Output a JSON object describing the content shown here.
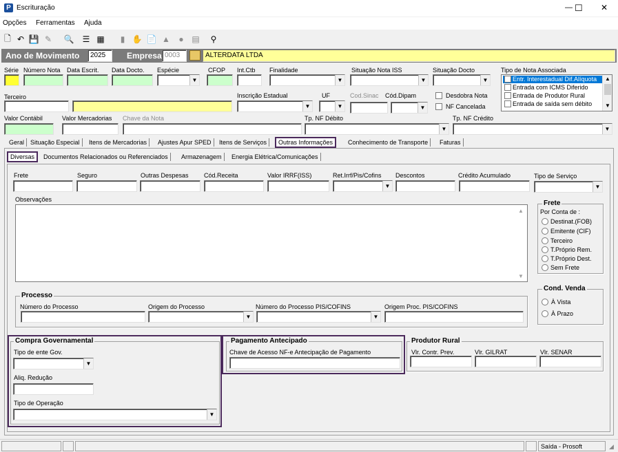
{
  "window": {
    "title": "Escrituração",
    "minimize": "—",
    "maximize": "☐",
    "close": "✕"
  },
  "menu": [
    "Opções",
    "Ferramentas",
    "Ajuda"
  ],
  "header": {
    "ano_label": "Ano de Movimento",
    "ano_value": "2025",
    "empresa_label": "Empresa",
    "empresa_code": "0003",
    "empresa_name": "ALTERDATA LTDA"
  },
  "row1": {
    "serie": "Série",
    "numero_nota": "Número Nota",
    "data_escrit": "Data Escrit.",
    "data_docto": "Data Docto.",
    "especie": "Espécie",
    "cfop": "CFOP",
    "int_ctb": "Int.Ctb",
    "finalidade": "Finalidade",
    "situacao_nota_iss": "Situação Nota ISS",
    "situacao_docto": "Situação Docto",
    "tipo_nota_associada": "Tipo de Nota Associada"
  },
  "tipo_nota_list": [
    {
      "label": "Entr. Interestadual Dif.Alíquota",
      "selected": true
    },
    {
      "label": "Entrada com ICMS Diferido",
      "selected": false
    },
    {
      "label": "Entrada de Produtor Rural",
      "selected": false
    },
    {
      "label": "Entrada de saída sem débito",
      "selected": false
    }
  ],
  "row2": {
    "terceiro": "Terceiro",
    "inscricao_estadual": "Inscrição Estadual",
    "uf": "UF",
    "cod_sinac": "Cod.Sinac",
    "cod_dipam": "Cód.Dipam",
    "desdobra_nota": "Desdobra Nota",
    "nf_cancelada": "NF Cancelada"
  },
  "row3": {
    "valor_contabil": "Valor Contábil",
    "valor_mercadorias": "Valor Mercadorias",
    "chave_nota": "Chave da Nota",
    "tp_nf_debito": "Tp. NF Débito",
    "tp_nf_credito": "Tp. NF Crédito"
  },
  "tabs": [
    "Geral",
    "Situação Especial",
    "Itens de Mercadorias",
    "Ajustes Apur SPED",
    "Itens de Serviços",
    "Outras Informações",
    "Conhecimento de Transporte",
    "Faturas"
  ],
  "subtabs": [
    "Diversas",
    "Documentos Relacionados ou Referenciados",
    "Armazenagem",
    "Energia Elétrica/Comunicações"
  ],
  "diversas": {
    "frete": "Frete",
    "seguro": "Seguro",
    "outras_despesas": "Outras Despesas",
    "cod_receita": "Cód.Receita",
    "valor_irrf": "Valor IRRF(ISS)",
    "ret_irrf": "Ret.Irrf/Pis/Cofins",
    "descontos": "Descontos",
    "credito_acumulado": "Crédito Acumulado",
    "tipo_servico": "Tipo de Serviço",
    "observacoes": "Observações"
  },
  "frete_group": {
    "title": "Frete",
    "por_conta": "Por Conta de :",
    "options": [
      "Destinat.(FOB)",
      "Emitente (CIF)",
      "Terceiro",
      "T.Próprio Rem.",
      "T.Próprio Dest.",
      "Sem Frete"
    ]
  },
  "cond_venda": {
    "title": "Cond. Venda",
    "options": [
      "À Vista",
      "À Prazo"
    ]
  },
  "processo": {
    "title": "Processo",
    "numero": "Número do Processo",
    "origem": "Origem do Processo",
    "numero_pis": "Número do Processo PIS/COFINS",
    "origem_pis": "Origem Proc. PIS/COFINS"
  },
  "compra_gov": {
    "title": "Compra Governamental",
    "tipo_ente": "Tipo de ente Gov.",
    "aliq_reducao": "Aliq. Redução",
    "tipo_operacao": "Tipo de Operação"
  },
  "pagamento": {
    "title": "Pagamento Antecipado",
    "chave": "Chave de Acesso NF-e Antecipação de Pagamento"
  },
  "produtor": {
    "title": "Produtor Rural",
    "vlr_contr": "Vlr. Contr. Prev.",
    "vlr_gilrat": "Vlr. GILRAT",
    "vlr_senar": "Vlr. SENAR"
  },
  "status": {
    "right": "Saída - Prosoft"
  },
  "colors": {
    "highlight": "#4b2a5c",
    "header_bg": "#7b7b7b",
    "selected": "#0078d7"
  }
}
